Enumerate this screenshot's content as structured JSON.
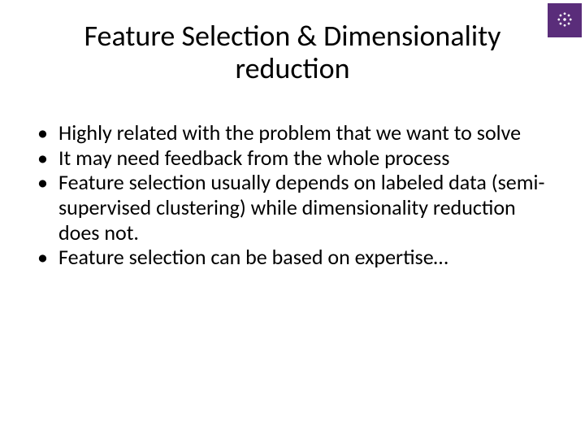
{
  "logo": {
    "line1": "",
    "line2": ""
  },
  "title": "Feature Selection & Dimensionality reduction",
  "bullets": [
    "Highly related with the problem that we want to solve",
    "It may need feedback from the whole process",
    "Feature selection usually depends on labeled data (semi-supervised clustering) while dimensionality reduction does not.",
    "Feature selection can be based on expertise…"
  ]
}
